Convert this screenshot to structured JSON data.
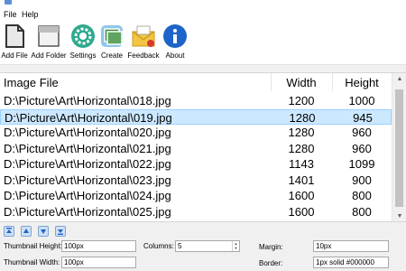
{
  "menu": {
    "file": "File",
    "help": "Help"
  },
  "toolbar": [
    {
      "label": "Add File",
      "icon": "add-file-icon"
    },
    {
      "label": "Add Folder",
      "icon": "add-folder-icon"
    },
    {
      "label": "Settings",
      "icon": "gear-icon"
    },
    {
      "label": "Create",
      "icon": "create-icon"
    },
    {
      "label": "Feedback",
      "icon": "mail-icon"
    },
    {
      "label": "About",
      "icon": "info-icon"
    }
  ],
  "list": {
    "columns": {
      "file": "Image File",
      "width": "Width",
      "height": "Height"
    },
    "rows": [
      {
        "file": "D:\\Picture\\Art\\Horizontal\\018.jpg",
        "width": "1200",
        "height": "1000"
      },
      {
        "file": "D:\\Picture\\Art\\Horizontal\\019.jpg",
        "width": "1280",
        "height": "945"
      },
      {
        "file": "D:\\Picture\\Art\\Horizontal\\020.jpg",
        "width": "1280",
        "height": "960"
      },
      {
        "file": "D:\\Picture\\Art\\Horizontal\\021.jpg",
        "width": "1280",
        "height": "960"
      },
      {
        "file": "D:\\Picture\\Art\\Horizontal\\022.jpg",
        "width": "1143",
        "height": "1099"
      },
      {
        "file": "D:\\Picture\\Art\\Horizontal\\023.jpg",
        "width": "1401",
        "height": "900"
      },
      {
        "file": "D:\\Picture\\Art\\Horizontal\\024.jpg",
        "width": "1600",
        "height": "800"
      },
      {
        "file": "D:\\Picture\\Art\\Horizontal\\025.jpg",
        "width": "1600",
        "height": "800"
      }
    ],
    "selected_row": 1
  },
  "order_buttons": [
    "move-top-icon",
    "move-up-icon",
    "move-down-icon",
    "move-bottom-icon"
  ],
  "settings": {
    "thumb_height_label": "Thumbnail Height:",
    "thumb_height": "100px",
    "thumb_width_label": "Thumbnail Width:",
    "thumb_width": "100px",
    "columns_label": "Columns:",
    "columns": "5",
    "margin_label": "Margin:",
    "margin": "10px",
    "border_label": "Border:",
    "border": "1px solid #000000"
  },
  "colors": {
    "selection": "#cce8ff",
    "accent": "#1e64c8"
  }
}
